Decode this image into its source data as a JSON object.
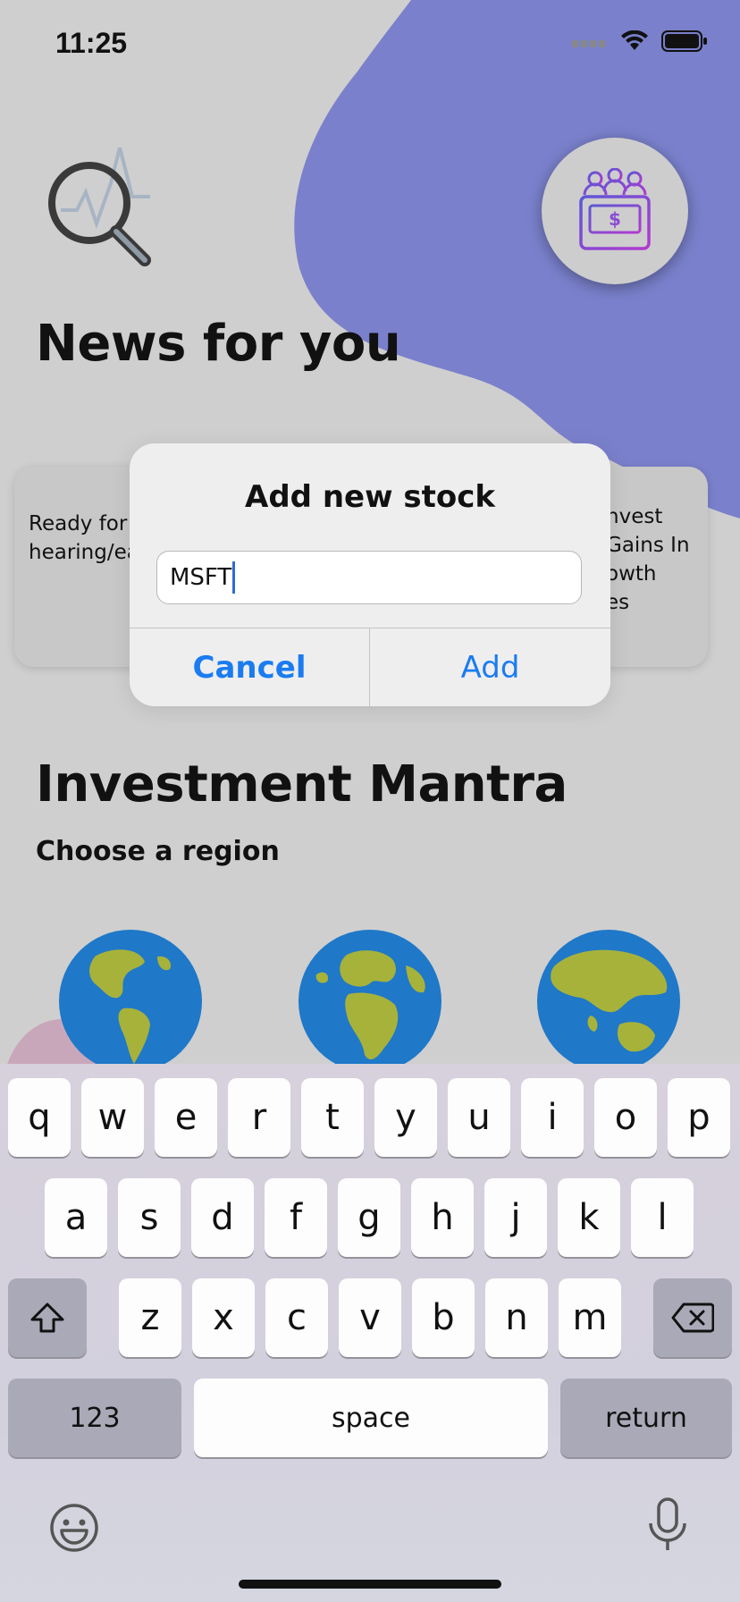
{
  "status": {
    "time": "11:25"
  },
  "news": {
    "title": "News for you",
    "left_card_text": "Ready for another Bi hearing/ea doublehea",
    "right_card_text": "nvest\nGains In\nowth\nes"
  },
  "investment": {
    "title": "Investment Mantra",
    "region_label": "Choose a region"
  },
  "regions": [
    {
      "icon": "globe-americas-icon"
    },
    {
      "icon": "globe-europe-africa-icon"
    },
    {
      "icon": "globe-asia-australia-icon"
    }
  ],
  "dialog": {
    "title": "Add new stock",
    "input_value": "MSFT",
    "cancel_label": "Cancel",
    "add_label": "Add"
  },
  "keyboard": {
    "row1": [
      "q",
      "w",
      "e",
      "r",
      "t",
      "y",
      "u",
      "i",
      "o",
      "p"
    ],
    "row2": [
      "a",
      "s",
      "d",
      "f",
      "g",
      "h",
      "j",
      "k",
      "l"
    ],
    "row3": [
      "z",
      "x",
      "c",
      "v",
      "b",
      "n",
      "m"
    ],
    "numbers_label": "123",
    "space_label": "space",
    "return_label": "return"
  },
  "colors": {
    "accent_blob": "#7a80cb",
    "link_blue": "#1a7cf0",
    "globe_ocean": "#1f78c8",
    "globe_land": "#a7b23a"
  }
}
